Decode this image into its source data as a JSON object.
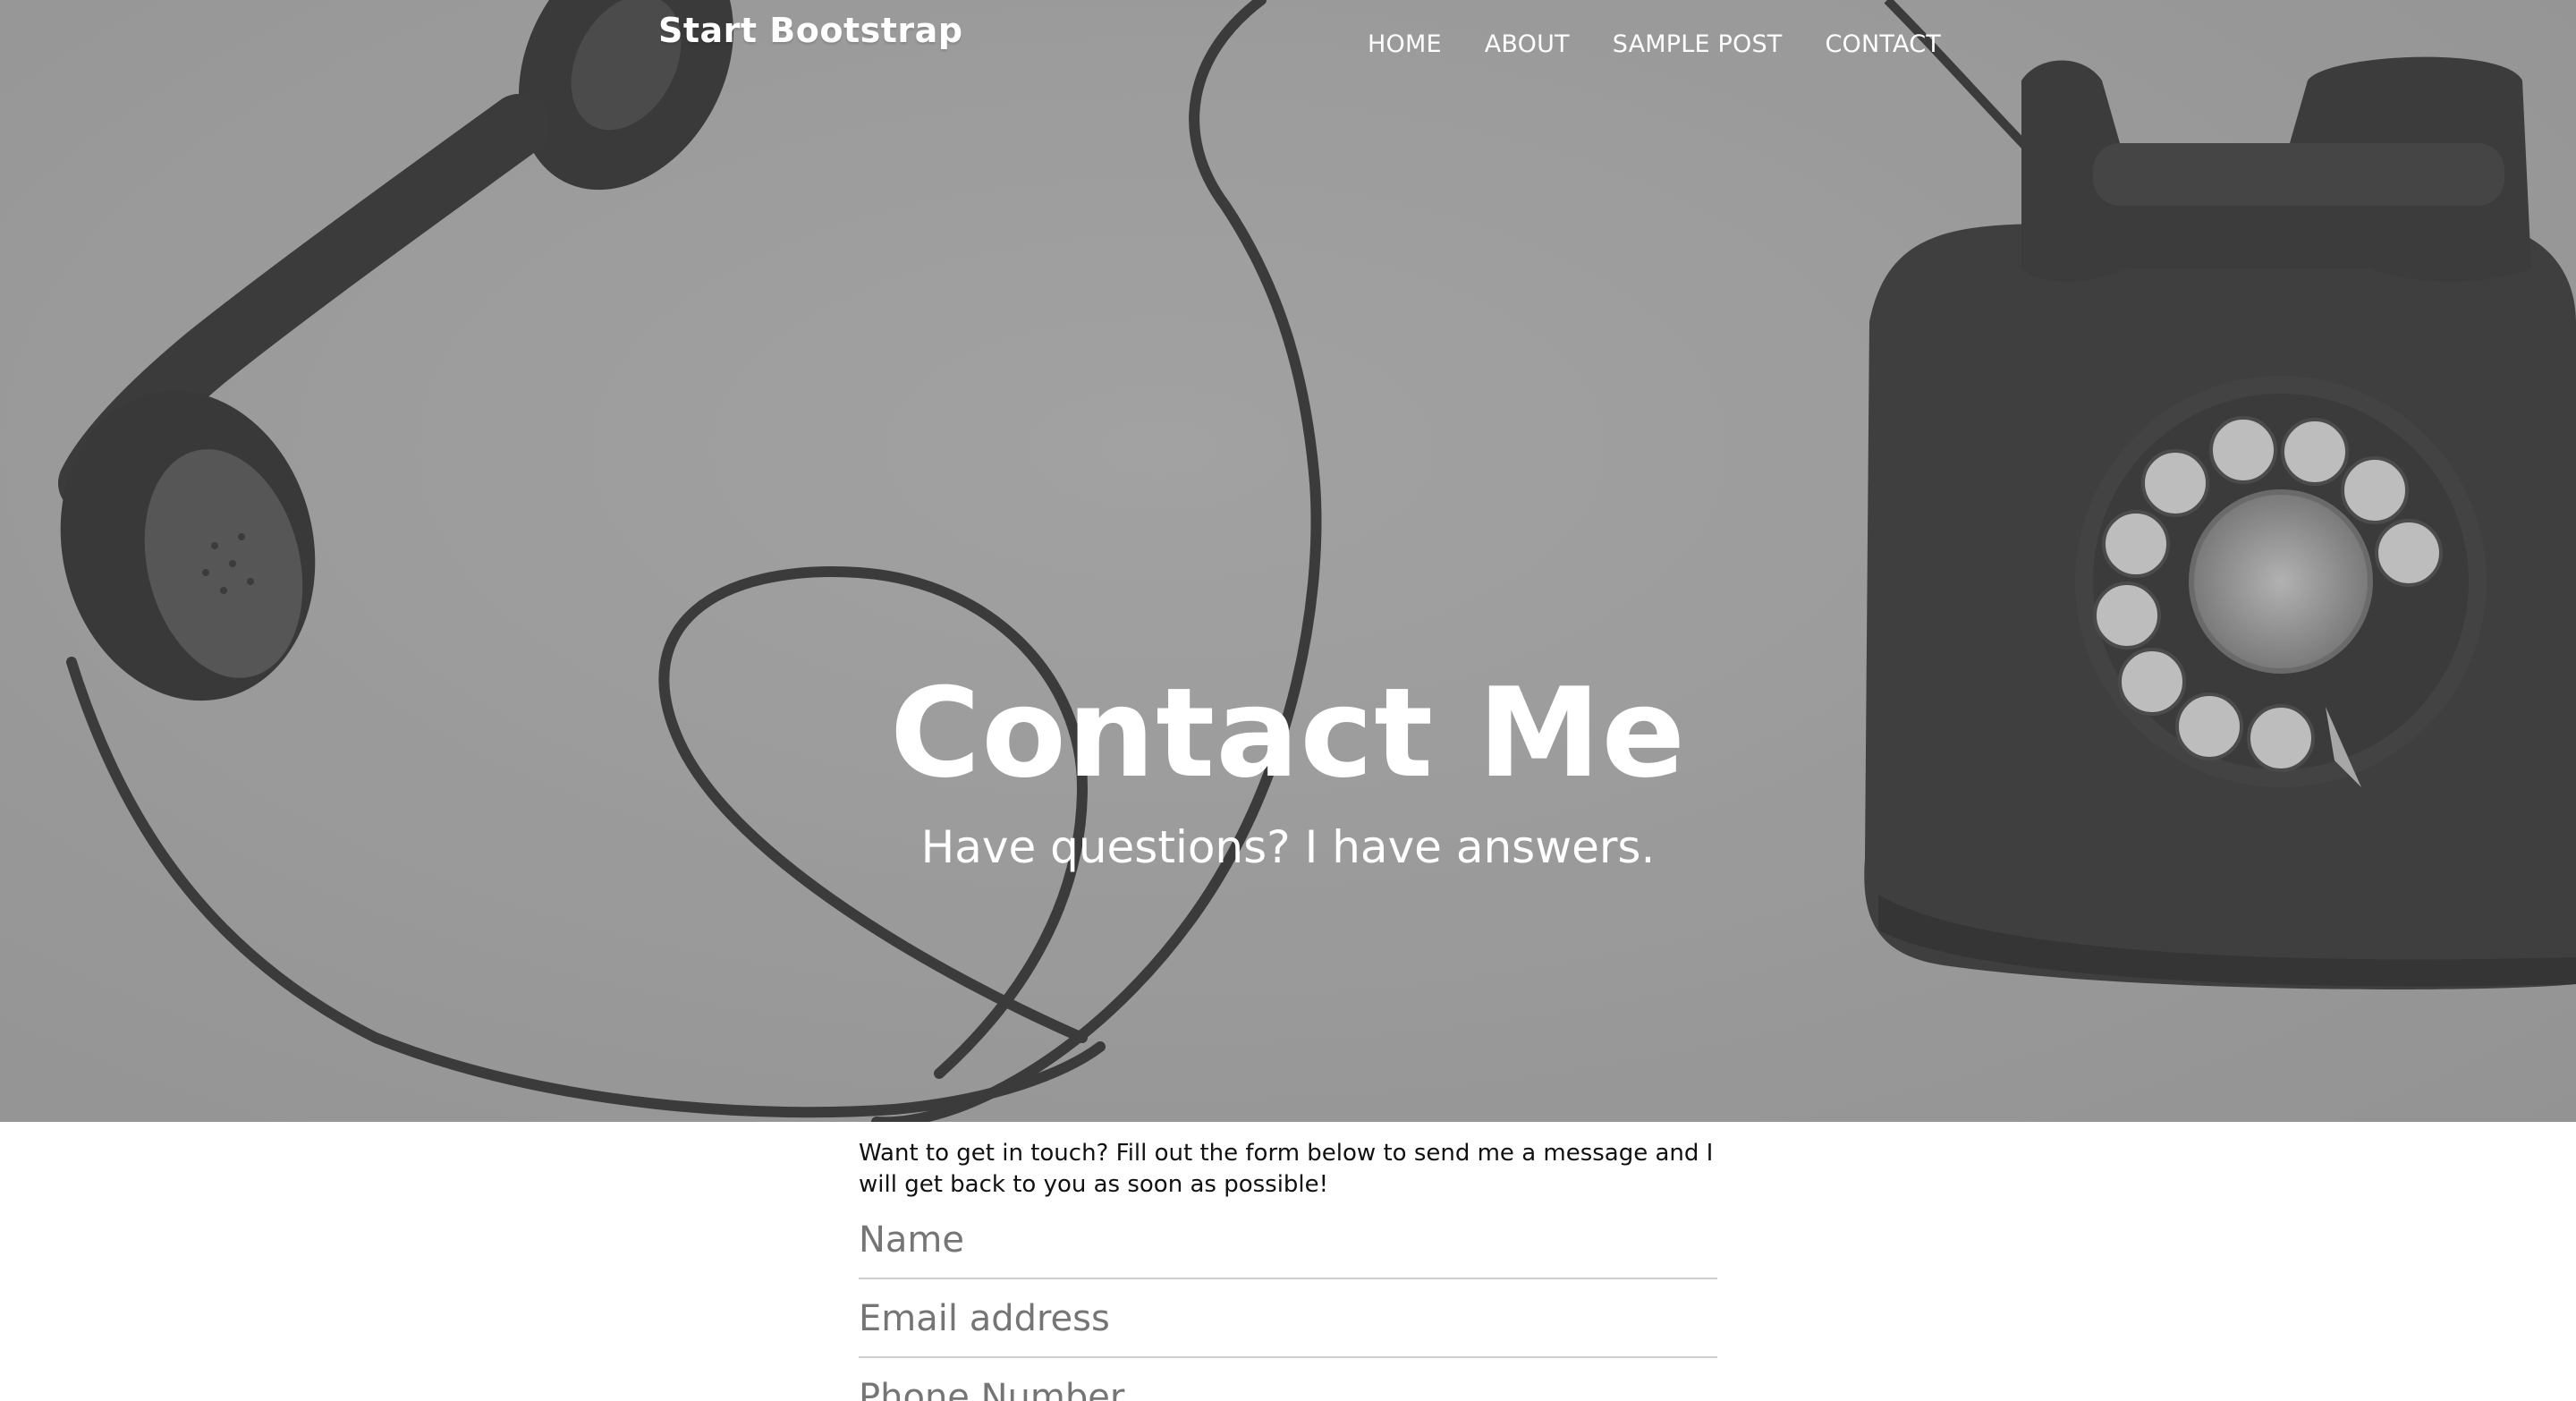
{
  "navbar": {
    "brand": "Start Bootstrap",
    "links": [
      {
        "label": "HOME"
      },
      {
        "label": "ABOUT"
      },
      {
        "label": "SAMPLE POST"
      },
      {
        "label": "CONTACT"
      }
    ]
  },
  "hero": {
    "title": "Contact Me",
    "subtitle": "Have questions? I have answers."
  },
  "content": {
    "intro": "Want to get in touch? Fill out the form below to send me a message and I will get back to you as soon as possible!",
    "form": {
      "name_placeholder": "Name",
      "email_placeholder": "Email address",
      "phone_placeholder": "Phone Number"
    }
  },
  "colors": {
    "hero_overlay": "#979797",
    "text_on_hero": "#ffffff",
    "body_text": "#111111",
    "placeholder": "#757575",
    "field_border": "#cfcfcf"
  }
}
